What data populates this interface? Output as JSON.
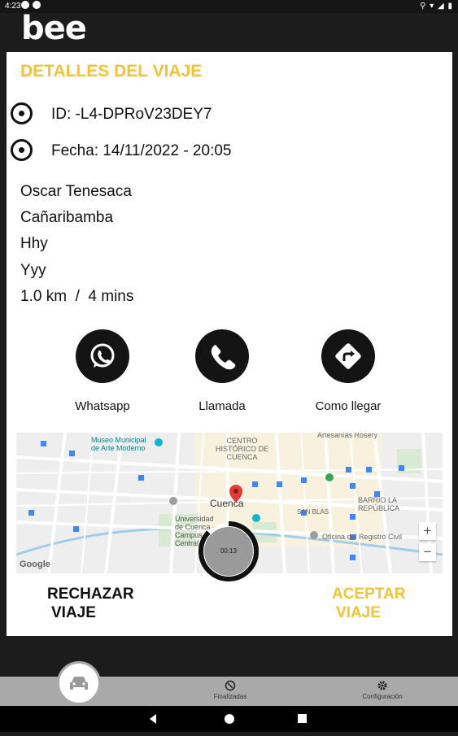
{
  "status_bar": {
    "time": "4:23"
  },
  "header": {
    "logo": "bee"
  },
  "details": {
    "title": "DETALLES DEL VIAJE",
    "id_label": "ID: -L4-DPRoV23DEY7",
    "date_label": "Fecha: 14/11/2022 - 20:05",
    "passenger": "Oscar Tenesaca",
    "address": "Cañaribamba",
    "line3": "Hhy",
    "line4": "Yyy",
    "distance_time": "1.0 km  /  4 mins"
  },
  "actions": {
    "whatsapp": {
      "label": "Whatsapp",
      "icon": "whatsapp-icon"
    },
    "call": {
      "label": "Llamada",
      "icon": "phone-icon"
    },
    "directions": {
      "label": "Como llegar",
      "icon": "directions-icon"
    }
  },
  "map": {
    "labels": {
      "museo": "Museo Municipal de Arte Moderno",
      "centro": "CENTRO HISTÓRICO DE CUENCA",
      "cuenca": "Cuenca",
      "universidad": "Universidad de Cuenca - Campus Central",
      "barrio": "BARRIO LA REPÚBLICA",
      "oficina": "Oficina del Registro Civil",
      "san_blas": "SAN BLAS",
      "artesanias": "Artesanías Rosery",
      "google": "Google"
    },
    "zoom_in": "+",
    "zoom_out": "−",
    "colors": {
      "pin": "#e53935",
      "water": "#9fcdea",
      "park": "#c8e6c9"
    }
  },
  "buttons": {
    "reject_line1": "RECHAZAR",
    "reject_line2": "VIAJE",
    "accept_line1": "ACEPTAR",
    "accept_line2": "VIAJE"
  },
  "timer": {
    "text": "00:13",
    "progress": 0.87
  },
  "bottom_nav": {
    "finalizadas": "Finalizadas",
    "configuracion": "Configuración"
  },
  "colors": {
    "accent": "#f4c233",
    "dark": "#141414"
  }
}
